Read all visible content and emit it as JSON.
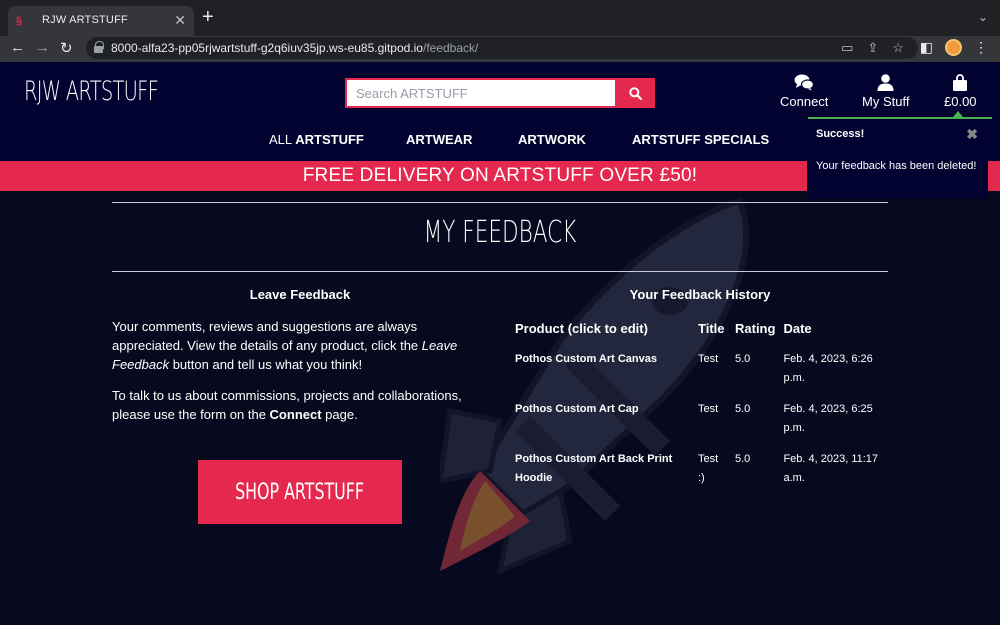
{
  "browser": {
    "tab_title": "RJW ARTSTUFF",
    "tab_close": "✕",
    "new_tab": "+",
    "url_host": "8000-alfa23-pp05rjwartstuff-g2q6iuv35jp.ws-eu85.gitpod.io",
    "url_path": "/feedback/"
  },
  "header": {
    "logo": "RJW ARTSTUFF",
    "search_placeholder": "Search ARTSTUFF",
    "connect_label": "Connect",
    "mystuff_label": "My Stuff",
    "cart_total": "£0.00"
  },
  "nav": {
    "all_prefix": "ALL ",
    "all_bold": "ARTSTUFF",
    "artwear": "ARTWEAR",
    "artwork": "ARTWORK",
    "specials": "ARTSTUFF SPECIALS"
  },
  "banner": "FREE DELIVERY ON ARTSTUFF OVER £50!",
  "toast": {
    "title": "Success!",
    "close": "✖",
    "message": "Your feedback has been deleted!"
  },
  "page": {
    "title": "MY FEEDBACK",
    "leave_title": "Leave Feedback",
    "para1_a": "Your comments, reviews and suggestions are always appreciated. View the details of any product, click the ",
    "para1_em": "Leave Feedback",
    "para1_b": " button and tell us what you think!",
    "para2_a": "To talk to us about commissions, projects and collaborations, please use the form on the ",
    "para2_bold": "Connect",
    "para2_b": " page.",
    "shop_button": "SHOP ARTSTUFF",
    "history_title": "Your Feedback History"
  },
  "table": {
    "headers": [
      "Product (click to edit)",
      "Title",
      "Rating",
      "Date"
    ],
    "rows": [
      {
        "product": "Pothos Custom Art Canvas",
        "title": "Test",
        "rating": "5.0",
        "date": "Feb. 4, 2023, 6:26 p.m."
      },
      {
        "product": "Pothos Custom Art Cap",
        "title": "Test",
        "rating": "5.0",
        "date": "Feb. 4, 2023, 6:25 p.m."
      },
      {
        "product": "Pothos Custom Art Back Print Hoodie",
        "title": "Test :)",
        "rating": "5.0",
        "date": "Feb. 4, 2023, 11:17 a.m."
      }
    ]
  },
  "colors": {
    "navy": "#020231",
    "accent_red": "#e4284e",
    "success_green": "#4caf50",
    "page_bg": "#070a1e"
  }
}
